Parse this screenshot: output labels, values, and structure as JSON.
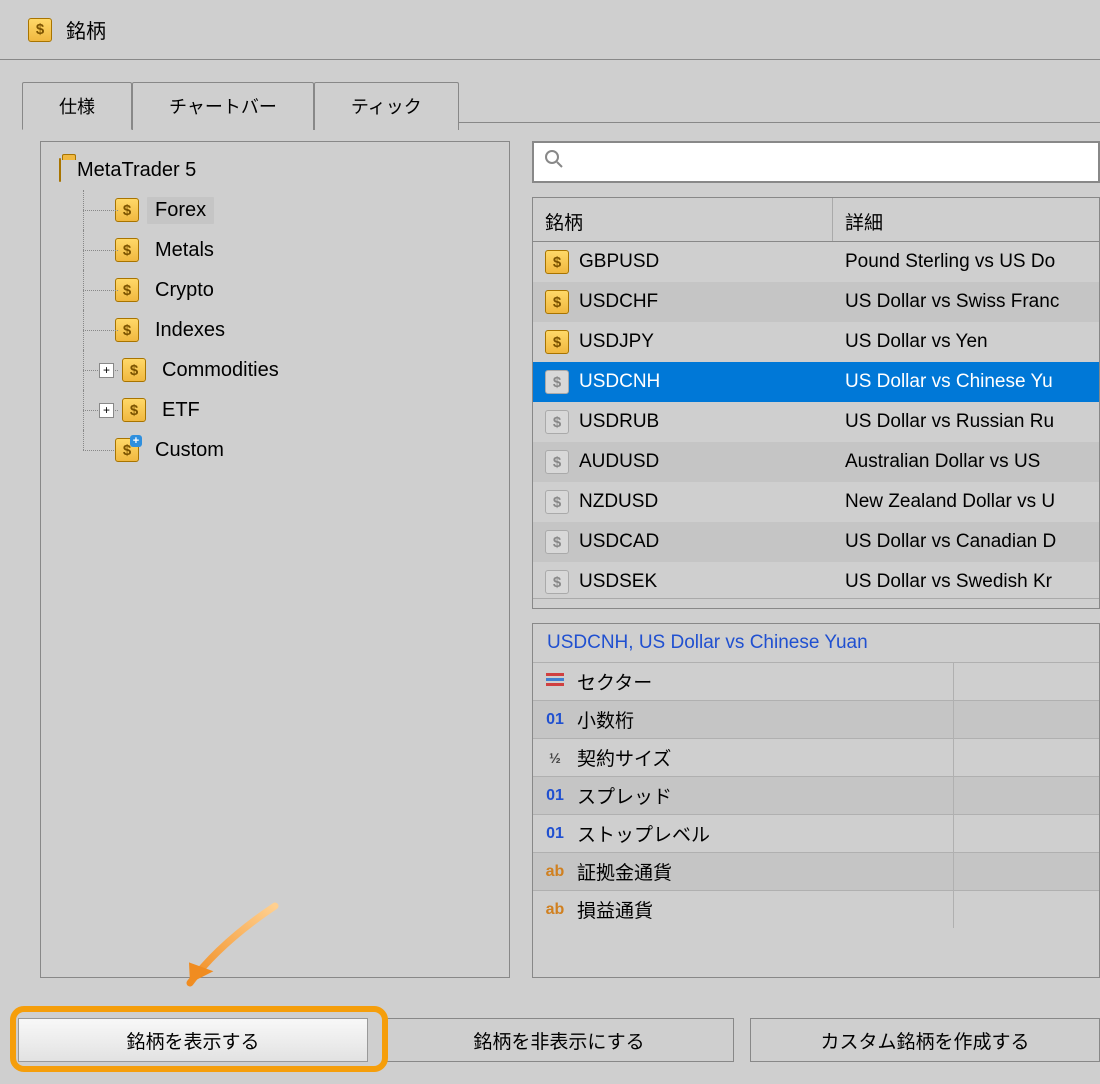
{
  "title": "銘柄",
  "tabs": [
    {
      "label": "仕様"
    },
    {
      "label": "チャートバー"
    },
    {
      "label": "ティック"
    }
  ],
  "tree": {
    "root": "MetaTrader 5",
    "items": [
      {
        "label": "Forex",
        "selected": true,
        "icon": "active"
      },
      {
        "label": "Metals",
        "icon": "active"
      },
      {
        "label": "Crypto",
        "icon": "active"
      },
      {
        "label": "Indexes",
        "icon": "active"
      },
      {
        "label": "Commodities",
        "icon": "active",
        "expandable": true
      },
      {
        "label": "ETF",
        "icon": "active",
        "expandable": true
      },
      {
        "label": "Custom",
        "icon": "custom"
      }
    ]
  },
  "search_placeholder": "",
  "table": {
    "col_symbol": "銘柄",
    "col_detail": "詳細",
    "rows": [
      {
        "symbol": "GBPUSD",
        "detail": "Pound Sterling vs US Do",
        "active": true
      },
      {
        "symbol": "USDCHF",
        "detail": "US Dollar vs Swiss Franc",
        "active": true
      },
      {
        "symbol": "USDJPY",
        "detail": "US Dollar vs Yen",
        "active": true
      },
      {
        "symbol": "USDCNH",
        "detail": "US Dollar vs Chinese Yu",
        "active": false,
        "selected": true
      },
      {
        "symbol": "USDRUB",
        "detail": "US Dollar vs Russian Ru",
        "active": false
      },
      {
        "symbol": "AUDUSD",
        "detail": "Australian Dollar vs US ",
        "active": false
      },
      {
        "symbol": "NZDUSD",
        "detail": "New Zealand Dollar vs U",
        "active": false
      },
      {
        "symbol": "USDCAD",
        "detail": "US Dollar vs Canadian D",
        "active": false
      },
      {
        "symbol": "USDSEK",
        "detail": "US Dollar vs Swedish Kr",
        "active": false
      }
    ]
  },
  "props": {
    "title": "USDCNH, US Dollar vs Chinese Yuan",
    "rows": [
      {
        "icon": "bars",
        "label": "セクター"
      },
      {
        "icon": "01",
        "label": "小数桁"
      },
      {
        "icon": "half",
        "label": "契約サイズ"
      },
      {
        "icon": "01",
        "label": "スプレッド"
      },
      {
        "icon": "01",
        "label": "ストップレベル"
      },
      {
        "icon": "ab",
        "label": "証拠金通貨"
      },
      {
        "icon": "ab",
        "label": "損益通貨"
      }
    ]
  },
  "buttons": {
    "show": "銘柄を表示する",
    "hide": "銘柄を非表示にする",
    "custom": "カスタム銘柄を作成する"
  }
}
